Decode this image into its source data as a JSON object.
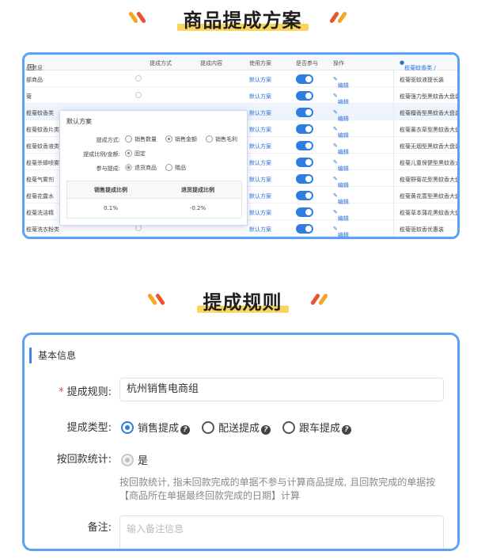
{
  "section1": {
    "title": "商品提成方案"
  },
  "table": {
    "headers": {
      "product": "品信息",
      "method": "提成方式",
      "content": "提成内容",
      "plan": "使用方案",
      "participate": "是否参与",
      "action": "操作",
      "right": "榄菊蚊香类 /"
    },
    "rows": [
      {
        "name": "部商品",
        "plan": "默认方案",
        "edit": "编辑",
        "right": "榄菊驱蚊液提长装"
      },
      {
        "name": "菊",
        "plan": "默认方案",
        "edit": "编辑",
        "right": "榄菊强力型黑蚊香大盘装"
      },
      {
        "name": "榄菊蚊香类",
        "plan": "默认方案",
        "edit": "编辑",
        "right": "榄菊檀香型黑蚊香大盘装"
      },
      {
        "name": "榄菊蚊香片类",
        "plan": "默认方案",
        "edit": "编辑",
        "right": "榄菊薰衣草型黑蚊香大盘装"
      },
      {
        "name": "榄菊蚊香液类",
        "plan": "默认方案",
        "edit": "编辑",
        "right": "榄菊无烟型黑蚊香大盘装"
      },
      {
        "name": "榄菊杀蟑喷雾",
        "plan": "默认方案",
        "edit": "编辑",
        "right": "榄菊儿童保健型黑蚊香大盘"
      },
      {
        "name": "榄菊气雾剂",
        "plan": "默认方案",
        "edit": "编辑",
        "right": "榄菊野菊花型黑蚊香大盘装"
      },
      {
        "name": "榄菊花露水",
        "plan": "默认方案",
        "edit": "编辑",
        "right": "榄菊黄花蒿型黑蚊香大盘装"
      },
      {
        "name": "榄菊洗洁精",
        "plan": "默认方案",
        "edit": "编辑",
        "right": "榄菊草本蒲花黑蚊香大盘装"
      },
      {
        "name": "榄菊洗衣粉类",
        "plan": "默认方案",
        "edit": "编辑",
        "right": "榄菊驱蚊香优惠装"
      }
    ]
  },
  "popup": {
    "title": "默认方案",
    "method_label": "提成方式:",
    "method_options": [
      "销售数量",
      "销售金额",
      "销售毛利"
    ],
    "ratio_label": "提成比例/金额:",
    "ratio_option": "固定",
    "participate_label": "参与提成:",
    "participate_options": [
      "退货商品",
      "赠品"
    ],
    "table_headers": [
      "销售提成比例",
      "退货提成比例"
    ],
    "table_values": [
      "0.1%",
      "-0.2%"
    ]
  },
  "section2": {
    "title": "提成规则"
  },
  "form": {
    "section_title": "基本信息",
    "rule_label": "提成规则:",
    "rule_value": "杭州销售电商组",
    "type_label": "提成类型:",
    "type_options": [
      "销售提成",
      "配送提成",
      "跟车提成"
    ],
    "stat_label": "按回款统计:",
    "stat_option": "是",
    "hint": "按回款统计, 指未回款完成的单据不参与计算商品提成, 且回款完成的单据按【商品所在单据最终回款完成的日期】计算",
    "remark_label": "备注:",
    "remark_placeholder": "输入备注信息"
  },
  "colors": {
    "accent": "#2f7de1",
    "card_border": "#5aa2f5",
    "highlight": "#f9d55a"
  }
}
